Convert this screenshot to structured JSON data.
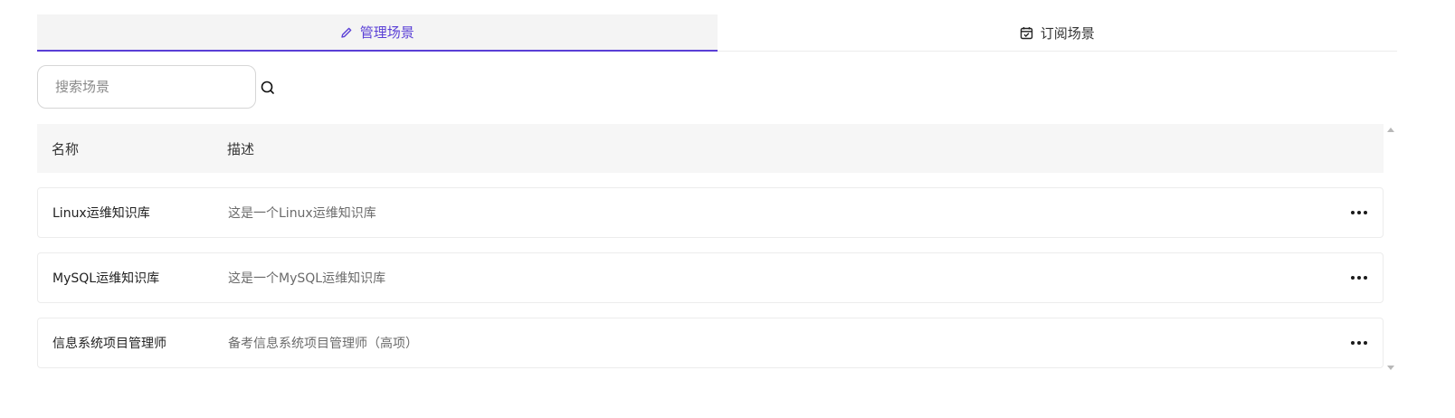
{
  "tabs": [
    {
      "label": "管理场景",
      "icon": "pencil-icon",
      "active": true
    },
    {
      "label": "订阅场景",
      "icon": "calendar-check-icon",
      "active": false
    }
  ],
  "search": {
    "placeholder": "搜索场景",
    "value": ""
  },
  "table": {
    "headers": {
      "name": "名称",
      "description": "描述"
    },
    "rows": [
      {
        "name": "Linux运维知识库",
        "description": "这是一个Linux运维知识库"
      },
      {
        "name": "MySQL运维知识库",
        "description": "这是一个MySQL运维知识库"
      },
      {
        "name": "信息系统项目管理师",
        "description": "备考信息系统项目管理师（高项）"
      }
    ]
  },
  "colors": {
    "accent": "#5a3fd6",
    "header_bg": "#f6f6f6"
  }
}
